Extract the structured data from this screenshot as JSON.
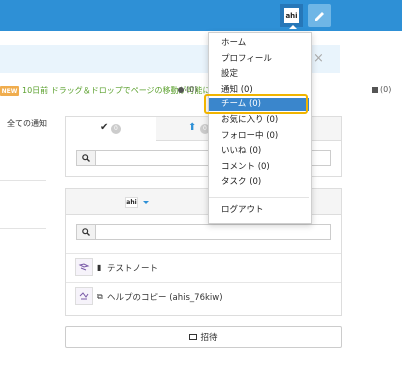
{
  "topbar": {
    "avatar_text": "ahi",
    "colors": {
      "bar": "#2e90d6",
      "avatar_bg": "#2677b8",
      "pen_bg": "#6fb6e6"
    }
  },
  "banner": {
    "close": "×"
  },
  "news": {
    "badge": "NEW",
    "text": "10日前 ドラッグ＆ドロップでページの移動が可能に",
    "counts": {
      "users": "(0)",
      "list": "(0)"
    }
  },
  "left": {
    "all_notifications": "全ての通知"
  },
  "tabs": {
    "badge1": "0",
    "badge2": "0"
  },
  "team_panel": {
    "avatar_text": "ahi",
    "notes": [
      {
        "label": "テストノート",
        "icon": "book-icon"
      },
      {
        "label": "ヘルプのコピー (ahis_76kiw)",
        "icon": "copy-icon"
      }
    ]
  },
  "invite_label": "招待",
  "menu": {
    "items": [
      "ホーム",
      "プロフィール",
      "設定",
      "通知 (0)",
      "チーム (0)",
      "お気に入り (0)",
      "フォロー中 (0)",
      "いいね (0)",
      "コメント (0)",
      "タスク (0)"
    ],
    "logout": "ログアウト",
    "selected_index": 4,
    "highlight_color": "#f0b400",
    "selected_color": "#3a86cc"
  }
}
